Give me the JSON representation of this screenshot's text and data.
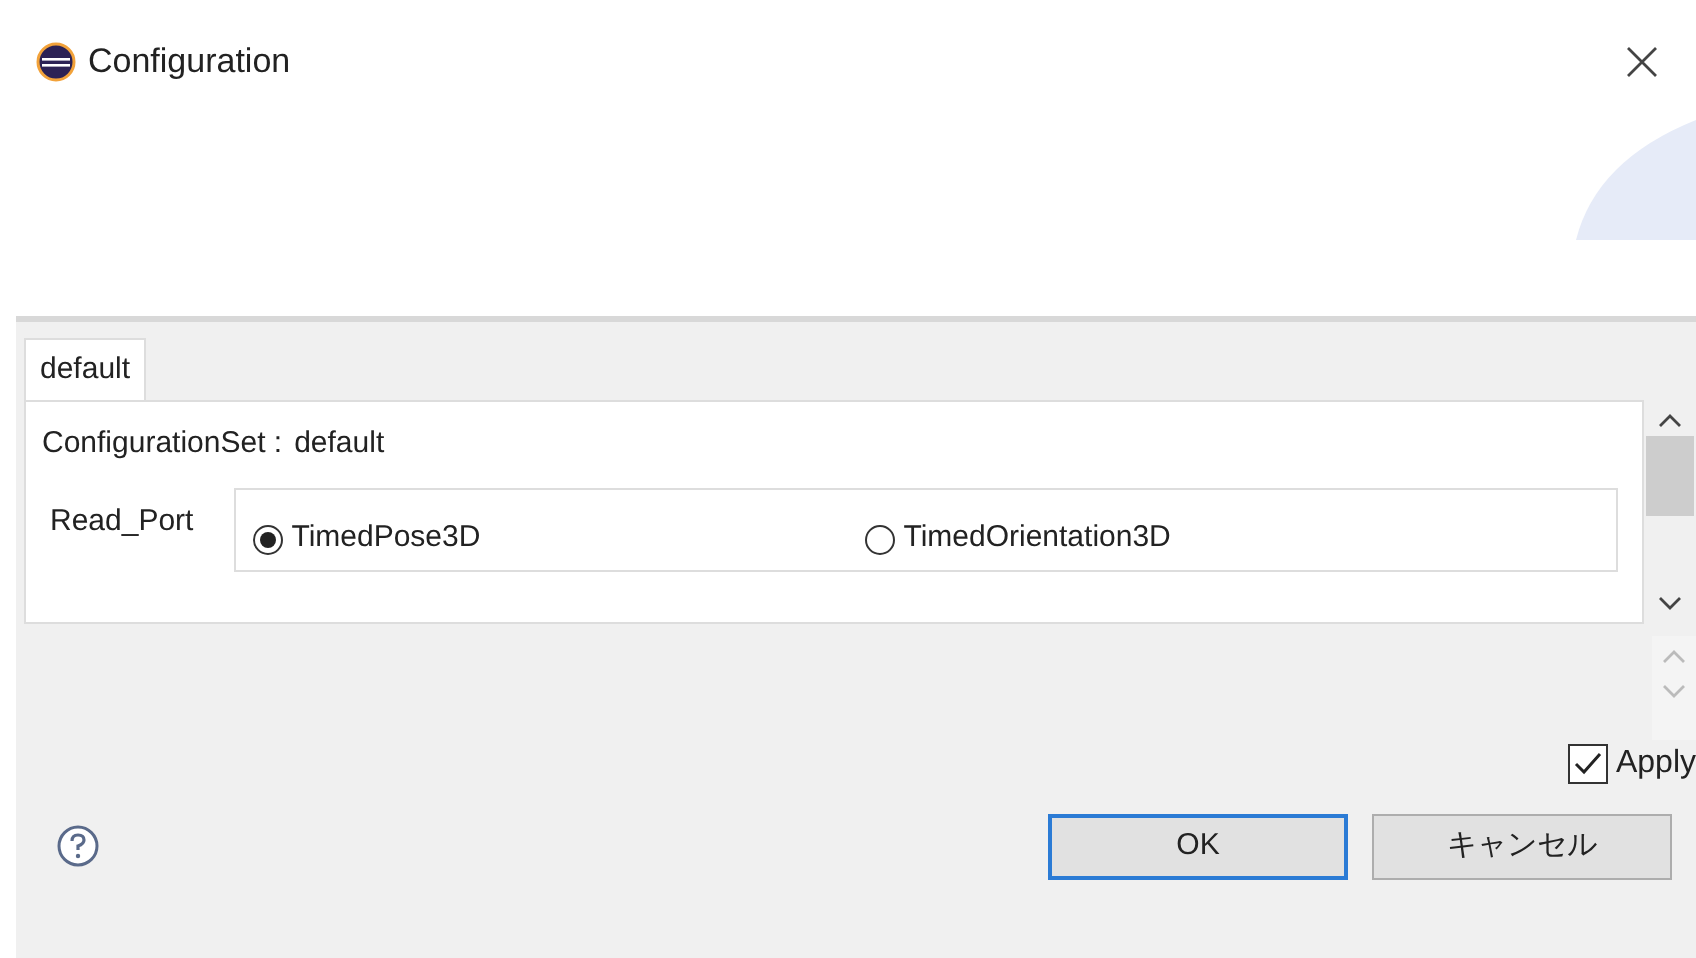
{
  "window": {
    "title": "Configuration"
  },
  "tabs": [
    {
      "label": "default",
      "selected": true
    }
  ],
  "configuration_set": {
    "label": "ConfigurationSet :",
    "value": "default"
  },
  "parameter": {
    "label": "Read_Port",
    "options": [
      {
        "label": "TimedPose3D",
        "selected": true
      },
      {
        "label": "TimedOrientation3D",
        "selected": false
      }
    ]
  },
  "apply": {
    "label": "Apply",
    "checked": true
  },
  "buttons": [
    {
      "label": "OK",
      "kind": "default"
    },
    {
      "label": "キャンセル",
      "kind": "normal"
    }
  ]
}
